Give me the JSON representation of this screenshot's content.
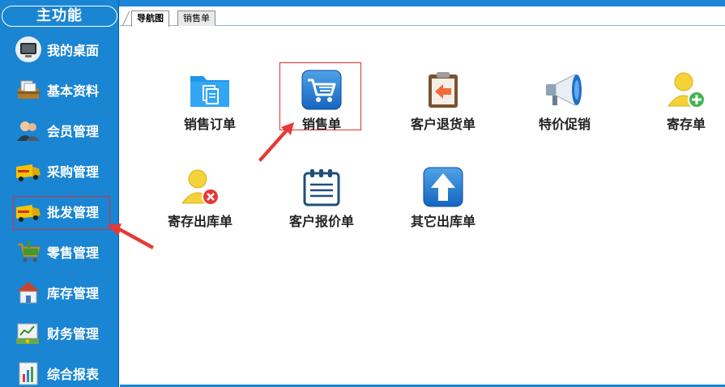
{
  "sidebar": {
    "title": "主功能",
    "items": [
      {
        "label": "我的桌面",
        "icon": "desktop-icon"
      },
      {
        "label": "基本资料",
        "icon": "files-box-icon"
      },
      {
        "label": "会员管理",
        "icon": "members-icon"
      },
      {
        "label": "采购管理",
        "icon": "truck-icon"
      },
      {
        "label": "批发管理",
        "icon": "truck-icon"
      },
      {
        "label": "零售管理",
        "icon": "shopping-cart-icon"
      },
      {
        "label": "库存管理",
        "icon": "house-icon"
      },
      {
        "label": "财务管理",
        "icon": "money-icon"
      },
      {
        "label": "综合报表",
        "icon": "report-chart-icon"
      }
    ],
    "highlighted": "批发管理"
  },
  "tabs": [
    {
      "label": "导航图",
      "active": true
    },
    {
      "label": "销售单",
      "active": false
    }
  ],
  "tiles": [
    {
      "label": "销售订单",
      "icon": "folder-document-icon"
    },
    {
      "label": "销售单",
      "icon": "shopping-cart-icon"
    },
    {
      "label": "客户退货单",
      "icon": "return-clipboard-icon"
    },
    {
      "label": "特价促销",
      "icon": "megaphone-icon"
    },
    {
      "label": "寄存单",
      "icon": "user-add-icon"
    },
    {
      "label": "寄存出库单",
      "icon": "user-remove-icon"
    },
    {
      "label": "客户报价单",
      "icon": "notepad-icon"
    },
    {
      "label": "其它出库单",
      "icon": "up-arrow-icon"
    }
  ],
  "highlighted_tile": "销售单",
  "colors": {
    "sidebar_bg": "#1a85d2",
    "highlight_red": "#e03030",
    "arrow_red": "#e53935"
  }
}
